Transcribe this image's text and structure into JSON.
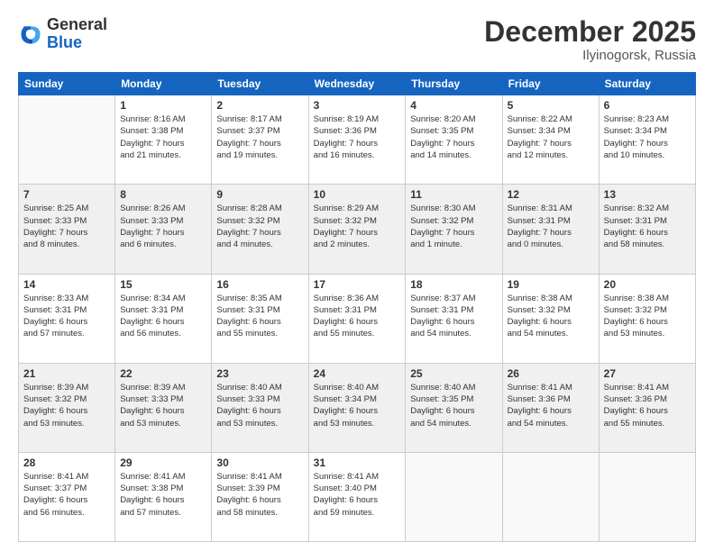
{
  "logo": {
    "general": "General",
    "blue": "Blue"
  },
  "header": {
    "month": "December 2025",
    "location": "Ilyinogorsk, Russia"
  },
  "weekdays": [
    "Sunday",
    "Monday",
    "Tuesday",
    "Wednesday",
    "Thursday",
    "Friday",
    "Saturday"
  ],
  "weeks": [
    [
      {
        "day": "",
        "info": ""
      },
      {
        "day": "1",
        "info": "Sunrise: 8:16 AM\nSunset: 3:38 PM\nDaylight: 7 hours\nand 21 minutes."
      },
      {
        "day": "2",
        "info": "Sunrise: 8:17 AM\nSunset: 3:37 PM\nDaylight: 7 hours\nand 19 minutes."
      },
      {
        "day": "3",
        "info": "Sunrise: 8:19 AM\nSunset: 3:36 PM\nDaylight: 7 hours\nand 16 minutes."
      },
      {
        "day": "4",
        "info": "Sunrise: 8:20 AM\nSunset: 3:35 PM\nDaylight: 7 hours\nand 14 minutes."
      },
      {
        "day": "5",
        "info": "Sunrise: 8:22 AM\nSunset: 3:34 PM\nDaylight: 7 hours\nand 12 minutes."
      },
      {
        "day": "6",
        "info": "Sunrise: 8:23 AM\nSunset: 3:34 PM\nDaylight: 7 hours\nand 10 minutes."
      }
    ],
    [
      {
        "day": "7",
        "info": "Sunrise: 8:25 AM\nSunset: 3:33 PM\nDaylight: 7 hours\nand 8 minutes."
      },
      {
        "day": "8",
        "info": "Sunrise: 8:26 AM\nSunset: 3:33 PM\nDaylight: 7 hours\nand 6 minutes."
      },
      {
        "day": "9",
        "info": "Sunrise: 8:28 AM\nSunset: 3:32 PM\nDaylight: 7 hours\nand 4 minutes."
      },
      {
        "day": "10",
        "info": "Sunrise: 8:29 AM\nSunset: 3:32 PM\nDaylight: 7 hours\nand 2 minutes."
      },
      {
        "day": "11",
        "info": "Sunrise: 8:30 AM\nSunset: 3:32 PM\nDaylight: 7 hours\nand 1 minute."
      },
      {
        "day": "12",
        "info": "Sunrise: 8:31 AM\nSunset: 3:31 PM\nDaylight: 7 hours\nand 0 minutes."
      },
      {
        "day": "13",
        "info": "Sunrise: 8:32 AM\nSunset: 3:31 PM\nDaylight: 6 hours\nand 58 minutes."
      }
    ],
    [
      {
        "day": "14",
        "info": "Sunrise: 8:33 AM\nSunset: 3:31 PM\nDaylight: 6 hours\nand 57 minutes."
      },
      {
        "day": "15",
        "info": "Sunrise: 8:34 AM\nSunset: 3:31 PM\nDaylight: 6 hours\nand 56 minutes."
      },
      {
        "day": "16",
        "info": "Sunrise: 8:35 AM\nSunset: 3:31 PM\nDaylight: 6 hours\nand 55 minutes."
      },
      {
        "day": "17",
        "info": "Sunrise: 8:36 AM\nSunset: 3:31 PM\nDaylight: 6 hours\nand 55 minutes."
      },
      {
        "day": "18",
        "info": "Sunrise: 8:37 AM\nSunset: 3:31 PM\nDaylight: 6 hours\nand 54 minutes."
      },
      {
        "day": "19",
        "info": "Sunrise: 8:38 AM\nSunset: 3:32 PM\nDaylight: 6 hours\nand 54 minutes."
      },
      {
        "day": "20",
        "info": "Sunrise: 8:38 AM\nSunset: 3:32 PM\nDaylight: 6 hours\nand 53 minutes."
      }
    ],
    [
      {
        "day": "21",
        "info": "Sunrise: 8:39 AM\nSunset: 3:32 PM\nDaylight: 6 hours\nand 53 minutes."
      },
      {
        "day": "22",
        "info": "Sunrise: 8:39 AM\nSunset: 3:33 PM\nDaylight: 6 hours\nand 53 minutes."
      },
      {
        "day": "23",
        "info": "Sunrise: 8:40 AM\nSunset: 3:33 PM\nDaylight: 6 hours\nand 53 minutes."
      },
      {
        "day": "24",
        "info": "Sunrise: 8:40 AM\nSunset: 3:34 PM\nDaylight: 6 hours\nand 53 minutes."
      },
      {
        "day": "25",
        "info": "Sunrise: 8:40 AM\nSunset: 3:35 PM\nDaylight: 6 hours\nand 54 minutes."
      },
      {
        "day": "26",
        "info": "Sunrise: 8:41 AM\nSunset: 3:36 PM\nDaylight: 6 hours\nand 54 minutes."
      },
      {
        "day": "27",
        "info": "Sunrise: 8:41 AM\nSunset: 3:36 PM\nDaylight: 6 hours\nand 55 minutes."
      }
    ],
    [
      {
        "day": "28",
        "info": "Sunrise: 8:41 AM\nSunset: 3:37 PM\nDaylight: 6 hours\nand 56 minutes."
      },
      {
        "day": "29",
        "info": "Sunrise: 8:41 AM\nSunset: 3:38 PM\nDaylight: 6 hours\nand 57 minutes."
      },
      {
        "day": "30",
        "info": "Sunrise: 8:41 AM\nSunset: 3:39 PM\nDaylight: 6 hours\nand 58 minutes."
      },
      {
        "day": "31",
        "info": "Sunrise: 8:41 AM\nSunset: 3:40 PM\nDaylight: 6 hours\nand 59 minutes."
      },
      {
        "day": "",
        "info": ""
      },
      {
        "day": "",
        "info": ""
      },
      {
        "day": "",
        "info": ""
      }
    ]
  ]
}
